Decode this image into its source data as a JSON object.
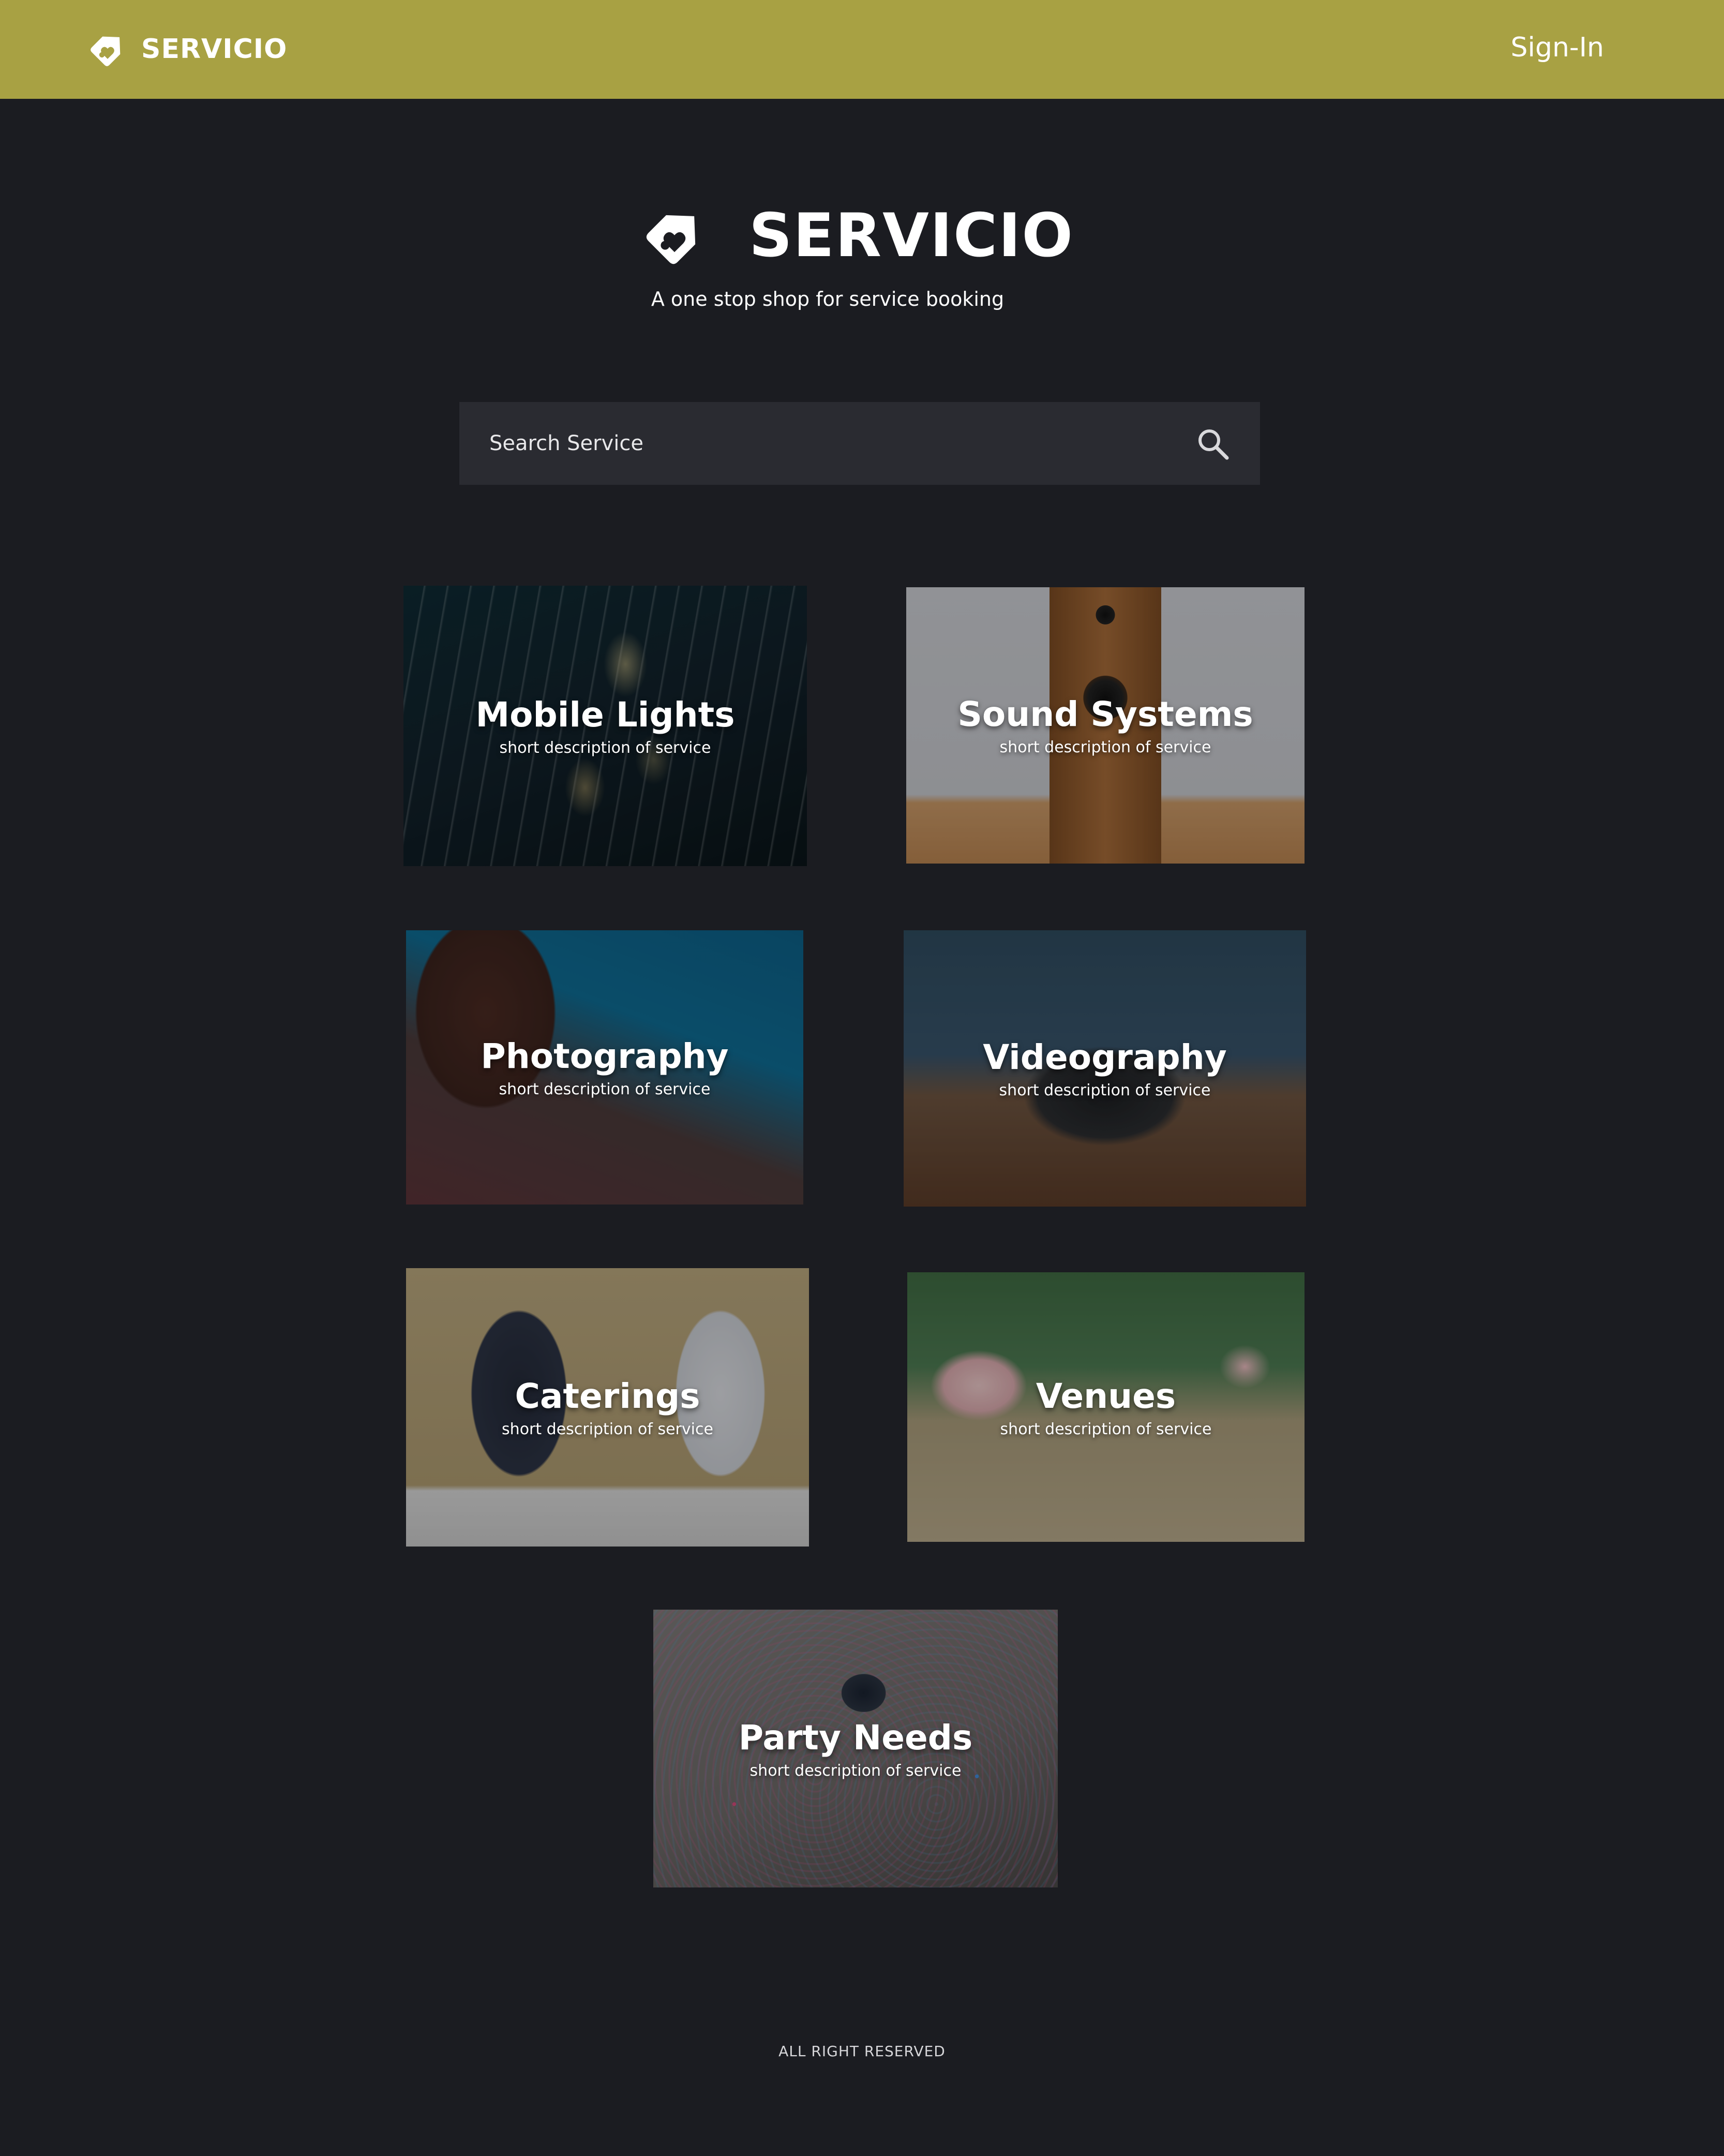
{
  "app": {
    "brand_name": "SERVICIO",
    "brand_color": "#a8a143",
    "background_color": "#1b1c21"
  },
  "nav": {
    "signin_label": "Sign-In"
  },
  "hero": {
    "title": "SERVICIO",
    "subtitle": "A one stop shop for service booking",
    "logo_icon": "tag-heart-icon"
  },
  "search": {
    "placeholder": "Search Service",
    "value": "",
    "icon": "search-icon"
  },
  "services": [
    {
      "title": "Mobile Lights",
      "description": "short description of service"
    },
    {
      "title": "Sound Systems",
      "description": "short description of service"
    },
    {
      "title": "Photography",
      "description": "short description of service"
    },
    {
      "title": "Videography",
      "description": "short description of service"
    },
    {
      "title": "Caterings",
      "description": "short description of service"
    },
    {
      "title": "Venues",
      "description": "short description of service"
    },
    {
      "title": "Party Needs",
      "description": "short description of service"
    }
  ],
  "footer": {
    "text": "ALL RIGHT RESERVED"
  }
}
